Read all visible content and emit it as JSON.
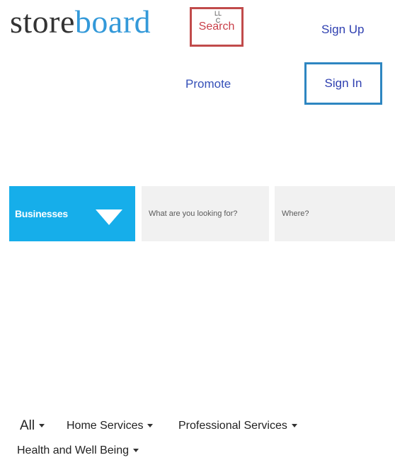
{
  "logo": {
    "part_dark": "store",
    "part_blue": "board",
    "tld": "LLC"
  },
  "header": {
    "search_label": "Search",
    "sign_up_label": "Sign Up",
    "promote_label": "Promote",
    "sign_in_label": "Sign In"
  },
  "search_bar": {
    "category_value": "Businesses",
    "what_placeholder": "What are you looking for?",
    "where_placeholder": "Where?"
  },
  "category_nav": {
    "items": [
      {
        "label": "All"
      },
      {
        "label": "Home Services"
      },
      {
        "label": "Professional Services"
      },
      {
        "label": "Health and Well Being"
      }
    ]
  },
  "colors": {
    "brand_blue": "#3399d9",
    "search_box_red": "#c14b4b",
    "sign_in_border": "#2e86c1",
    "category_select_bg": "#16aeea",
    "field_bg": "#f1f1f1"
  },
  "icons": {
    "category_dropdown": "triangle-down-icon",
    "nav_caret": "caret-down-icon"
  }
}
